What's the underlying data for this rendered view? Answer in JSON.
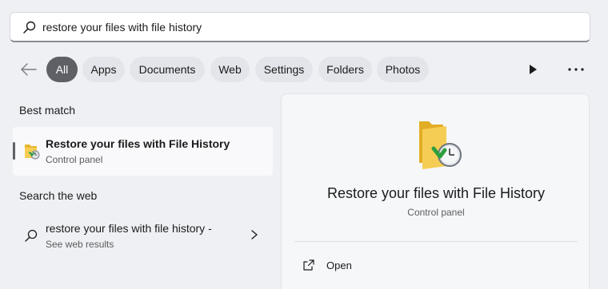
{
  "search": {
    "value": "restore your files with file history",
    "icon": "search-icon"
  },
  "filters": {
    "back_icon": "back-arrow-icon",
    "chips": [
      {
        "label": "All",
        "active": true
      },
      {
        "label": "Apps"
      },
      {
        "label": "Documents"
      },
      {
        "label": "Web"
      },
      {
        "label": "Settings"
      },
      {
        "label": "Folders"
      },
      {
        "label": "Photos"
      }
    ],
    "play_icon": "play-icon",
    "more_icon": "more-icon"
  },
  "best_match": {
    "heading": "Best match",
    "item": {
      "title": "Restore your files with File History",
      "subtitle": "Control panel",
      "icon": "file-history-icon"
    }
  },
  "web": {
    "heading": "Search the web",
    "item": {
      "title": "restore your files with file history -",
      "subtitle": "See web results",
      "icon": "search-icon",
      "chevron": "chevron-right-icon"
    }
  },
  "detail": {
    "title": "Restore your files with File History",
    "subtitle": "Control panel",
    "icon": "file-history-icon",
    "actions": [
      {
        "label": "Open",
        "icon": "open-external-icon"
      }
    ]
  },
  "colors": {
    "background": "#eef0f4",
    "active_chip": "#5e6066",
    "folder": "#f2c94c",
    "check_green": "#2e9e3e"
  }
}
